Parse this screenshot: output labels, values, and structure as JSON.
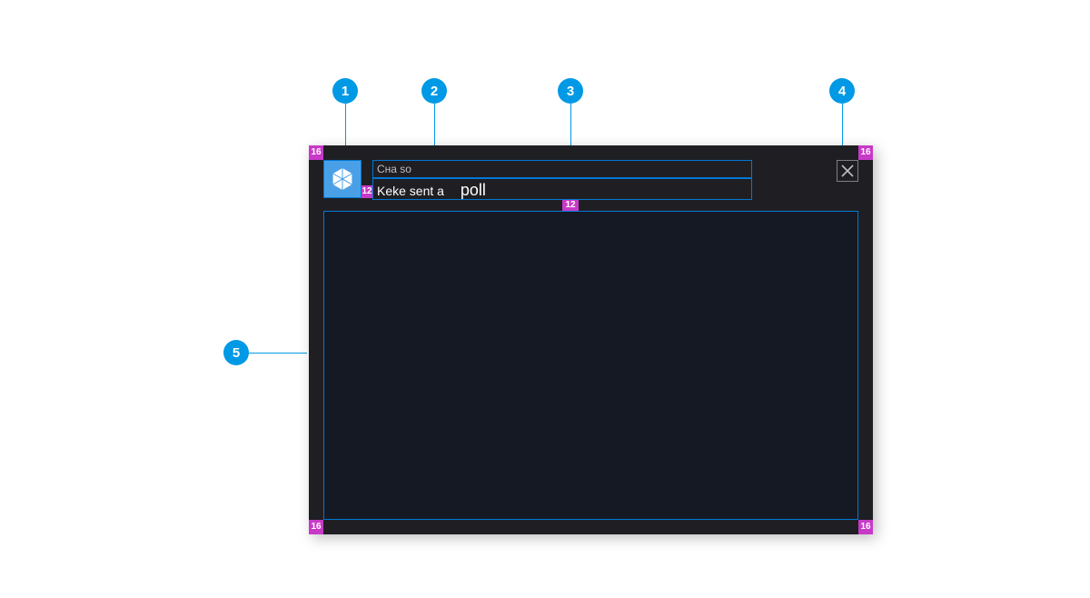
{
  "callouts": {
    "c1": "1",
    "c2": "2",
    "c3": "3",
    "c4": "4",
    "c5": "5"
  },
  "padding_label": "16",
  "gap_label": "12",
  "toast": {
    "title": "Cна so",
    "message_prefix": "Keke sent a",
    "message_emphasis": "poll"
  },
  "icons": {
    "app": "app-icon",
    "close": "close-icon"
  }
}
